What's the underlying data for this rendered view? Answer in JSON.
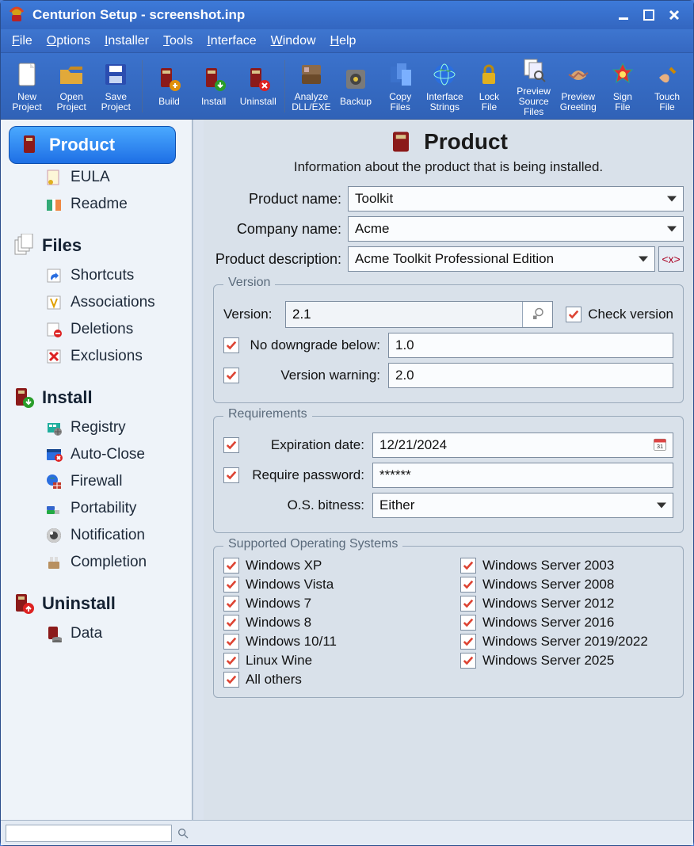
{
  "window": {
    "title": "Centurion Setup - screenshot.inp"
  },
  "menu": [
    "File",
    "Options",
    "Installer",
    "Tools",
    "Interface",
    "Window",
    "Help"
  ],
  "toolbar": [
    {
      "label": "New\nProject",
      "icon": "new"
    },
    {
      "label": "Open\nProject",
      "icon": "open"
    },
    {
      "label": "Save\nProject",
      "icon": "save"
    },
    {
      "sep": true
    },
    {
      "label": "Build",
      "icon": "build"
    },
    {
      "label": "Install",
      "icon": "install"
    },
    {
      "label": "Uninstall",
      "icon": "uninstall"
    },
    {
      "sep": true
    },
    {
      "label": "Analyze\nDLL/EXE",
      "icon": "analyze"
    },
    {
      "label": "Backup",
      "icon": "backup"
    },
    {
      "label": "Copy\nFiles",
      "icon": "copy"
    },
    {
      "label": "Interface\nStrings",
      "icon": "globe"
    },
    {
      "label": "Lock\nFile",
      "icon": "lock"
    },
    {
      "label": "Preview\nSource Files",
      "icon": "preview"
    },
    {
      "label": "Preview\nGreeting",
      "icon": "greet"
    },
    {
      "label": "Sign\nFile",
      "icon": "sign"
    },
    {
      "label": "Touch\nFile",
      "icon": "touch"
    }
  ],
  "sidebar": [
    {
      "title": "Product",
      "icon": "product",
      "active": true,
      "subs": [
        {
          "label": "EULA",
          "icon": "eula"
        },
        {
          "label": "Readme",
          "icon": "readme"
        }
      ]
    },
    {
      "title": "Files",
      "icon": "files",
      "subs": [
        {
          "label": "Shortcuts",
          "icon": "shortcut"
        },
        {
          "label": "Associations",
          "icon": "assoc"
        },
        {
          "label": "Deletions",
          "icon": "delete"
        },
        {
          "label": "Exclusions",
          "icon": "exclude"
        }
      ]
    },
    {
      "title": "Install",
      "icon": "install-box",
      "subs": [
        {
          "label": "Registry",
          "icon": "registry"
        },
        {
          "label": "Auto-Close",
          "icon": "autoclose"
        },
        {
          "label": "Firewall",
          "icon": "firewall"
        },
        {
          "label": "Portability",
          "icon": "usb"
        },
        {
          "label": "Notification",
          "icon": "notify"
        },
        {
          "label": "Completion",
          "icon": "complete"
        }
      ]
    },
    {
      "title": "Uninstall",
      "icon": "uninstall-box",
      "subs": [
        {
          "label": "Data",
          "icon": "data"
        }
      ]
    }
  ],
  "panel": {
    "title": "Product",
    "subtitle": "Information about the product that is being installed.",
    "labels": {
      "productName": "Product name:",
      "companyName": "Company name:",
      "productDesc": "Product description:",
      "versionFieldset": "Version",
      "version": "Version:",
      "checkVersion": "Check version",
      "noDowngrade": "No downgrade below:",
      "versionWarning": "Version warning:",
      "requirementsFieldset": "Requirements",
      "expDate": "Expiration date:",
      "reqPassword": "Require password:",
      "osBitness": "O.S. bitness:",
      "osFieldset": "Supported Operating Systems"
    },
    "values": {
      "productName": "Toolkit",
      "companyName": "Acme",
      "productDesc": "Acme Toolkit Professional Edition",
      "version": "2.1",
      "checkVersion": true,
      "noDowngradeOn": true,
      "noDowngrade": "1.0",
      "versionWarningOn": true,
      "versionWarning": "2.0",
      "expDateOn": true,
      "expDate": "12/21/2024",
      "reqPasswordOn": true,
      "reqPassword": "******",
      "osBitness": "Either",
      "os": [
        {
          "label": "Windows XP",
          "on": true
        },
        {
          "label": "Windows Server 2003",
          "on": true
        },
        {
          "label": "Windows Vista",
          "on": true
        },
        {
          "label": "Windows Server 2008",
          "on": true
        },
        {
          "label": "Windows 7",
          "on": true
        },
        {
          "label": "Windows Server 2012",
          "on": true
        },
        {
          "label": "Windows 8",
          "on": true
        },
        {
          "label": "Windows Server 2016",
          "on": true
        },
        {
          "label": "Windows 10/11",
          "on": true
        },
        {
          "label": "Windows Server 2019/2022",
          "on": true
        },
        {
          "label": "Linux Wine",
          "on": true
        },
        {
          "label": "Windows Server 2025",
          "on": true
        },
        {
          "label": "All others",
          "on": true
        }
      ]
    }
  }
}
